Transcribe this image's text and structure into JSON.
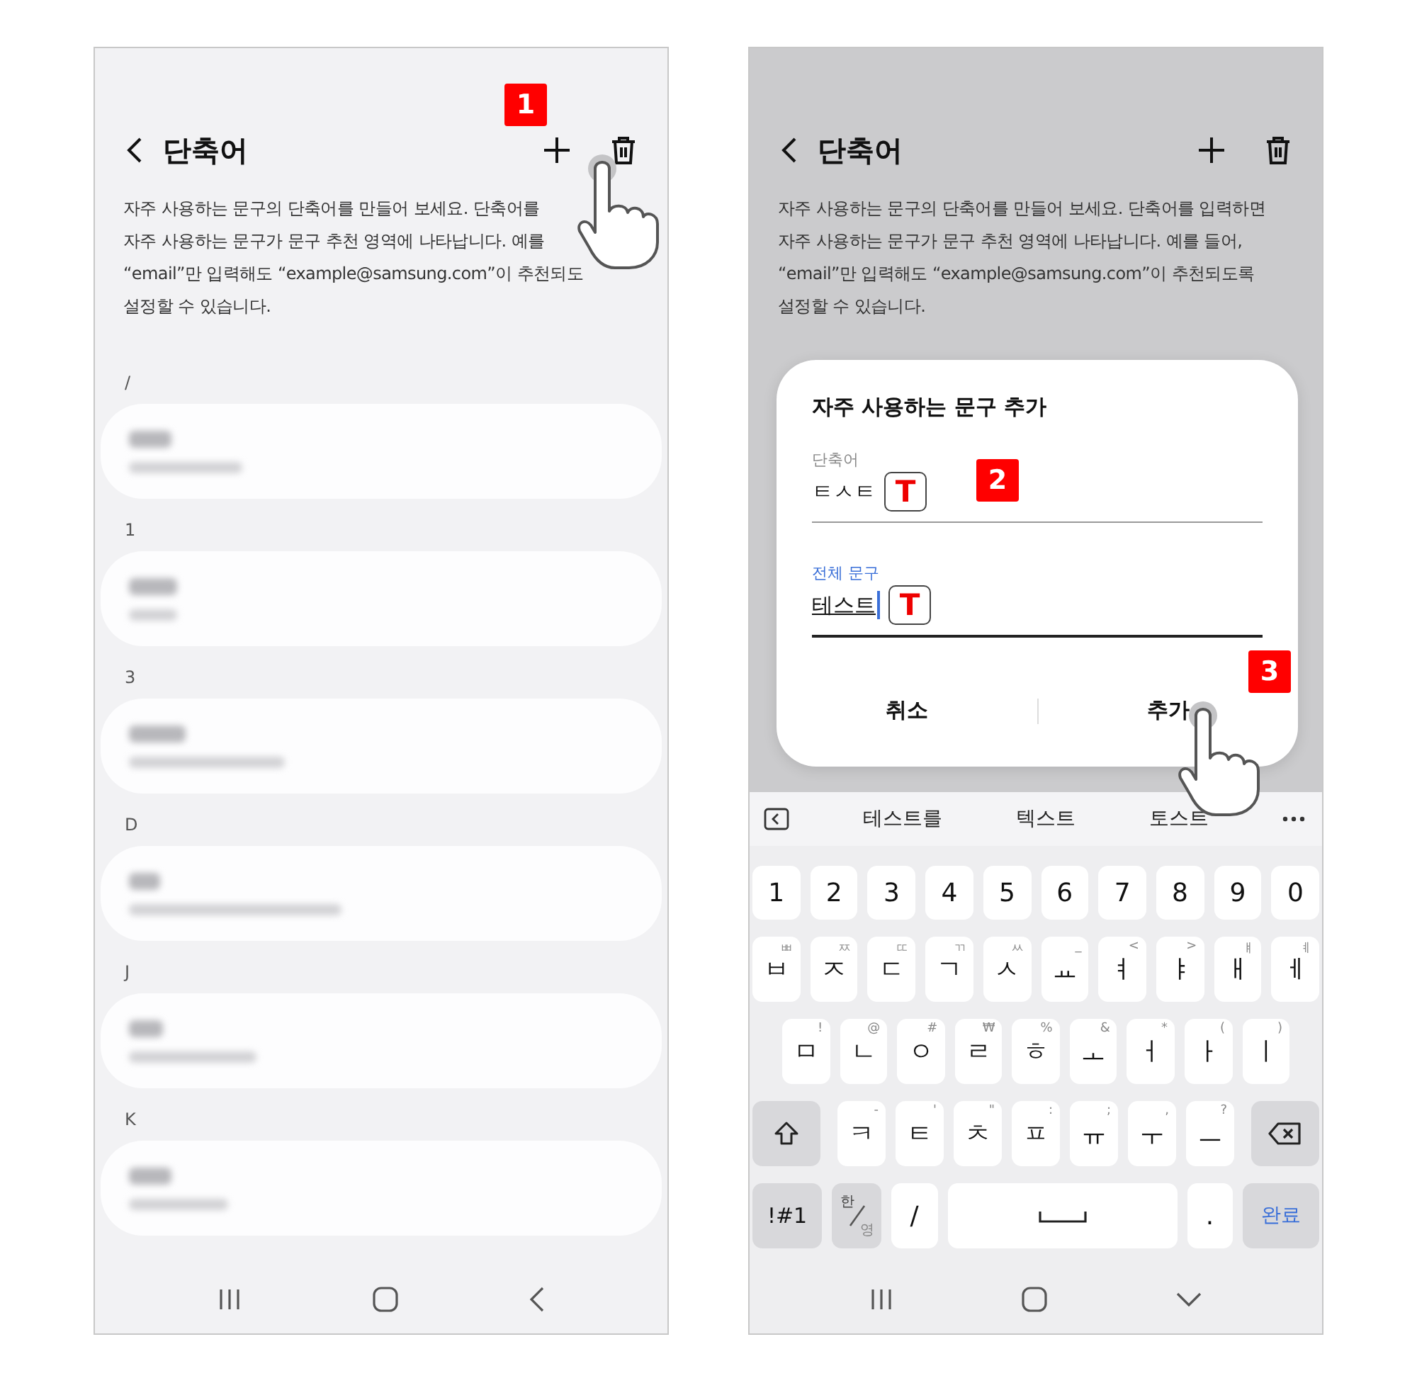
{
  "left_screen": {
    "title": "단축어",
    "step": "1",
    "description": [
      "자주 사용하는 문구의 단축어를 만들어 보세요. 단축어를",
      "자주 사용하는 문구가 문구 추천 영역에 나타납니다. 예를",
      "“email”만 입력해도 “example@samsung.com”이 추천되도",
      "설정할 수 있습니다."
    ],
    "sections": [
      {
        "header": "/"
      },
      {
        "header": "1"
      },
      {
        "header": "3"
      },
      {
        "header": "D"
      },
      {
        "header": "J"
      },
      {
        "header": "K"
      }
    ]
  },
  "right_screen": {
    "title": "단축어",
    "description": [
      "자주 사용하는 문구의 단축어를 만들어 보세요. 단축어를 입력하면",
      "자주 사용하는 문구가 문구 추천 영역에 나타납니다. 예를 들어,",
      "“email”만 입력해도 “example@samsung.com”이 추천되도록",
      "설정할 수 있습니다."
    ],
    "dialog": {
      "title": "자주 사용하는 문구 추가",
      "fields": [
        {
          "label": "단축어",
          "value": "ㅌㅅㅌ",
          "badge": "T",
          "focused": false,
          "step": "2"
        },
        {
          "label": "전체 문구",
          "value": "테스트",
          "badge": "T",
          "focused": true
        }
      ],
      "buttons": [
        {
          "label": "취소"
        },
        {
          "label": "추가",
          "step": "3"
        }
      ]
    },
    "keyboard": {
      "suggestions": [
        "테스트를",
        "텍스트",
        "토스트"
      ],
      "rows": [
        [
          {
            "kind": "char",
            "main": "1"
          },
          {
            "kind": "char",
            "main": "2"
          },
          {
            "kind": "char",
            "main": "3"
          },
          {
            "kind": "char",
            "main": "4"
          },
          {
            "kind": "char",
            "main": "5"
          },
          {
            "kind": "char",
            "main": "6"
          },
          {
            "kind": "char",
            "main": "7"
          },
          {
            "kind": "char",
            "main": "8"
          },
          {
            "kind": "char",
            "main": "9"
          },
          {
            "kind": "char",
            "main": "0"
          }
        ],
        [
          {
            "kind": "char",
            "main": "ㅂ",
            "hint": "ㅃ"
          },
          {
            "kind": "char",
            "main": "ㅈ",
            "hint": "ㅉ"
          },
          {
            "kind": "char",
            "main": "ㄷ",
            "hint": "ㄸ"
          },
          {
            "kind": "char",
            "main": "ㄱ",
            "hint": "ㄲ"
          },
          {
            "kind": "char",
            "main": "ㅅ",
            "hint": "ㅆ"
          },
          {
            "kind": "char",
            "main": "ㅛ",
            "hint": "_"
          },
          {
            "kind": "char",
            "main": "ㅕ",
            "hint": "<"
          },
          {
            "kind": "char",
            "main": "ㅑ",
            "hint": ">"
          },
          {
            "kind": "char",
            "main": "ㅐ",
            "hint": "ㅒ"
          },
          {
            "kind": "char",
            "main": "ㅔ",
            "hint": "ㅖ"
          }
        ],
        [
          {
            "kind": "char",
            "main": "ㅁ",
            "hint": "!"
          },
          {
            "kind": "char",
            "main": "ㄴ",
            "hint": "@"
          },
          {
            "kind": "char",
            "main": "ㅇ",
            "hint": "#"
          },
          {
            "kind": "char",
            "main": "ㄹ",
            "hint": "₩"
          },
          {
            "kind": "char",
            "main": "ㅎ",
            "hint": "%"
          },
          {
            "kind": "char",
            "main": "ㅗ",
            "hint": "&"
          },
          {
            "kind": "char",
            "main": "ㅓ",
            "hint": "*"
          },
          {
            "kind": "char",
            "main": "ㅏ",
            "hint": "("
          },
          {
            "kind": "char",
            "main": "ㅣ",
            "hint": ")"
          }
        ],
        [
          {
            "kind": "shift"
          },
          {
            "kind": "char",
            "main": "ㅋ",
            "hint": "-"
          },
          {
            "kind": "char",
            "main": "ㅌ",
            "hint": "'"
          },
          {
            "kind": "char",
            "main": "ㅊ",
            "hint": "\""
          },
          {
            "kind": "char",
            "main": "ㅍ",
            "hint": ":"
          },
          {
            "kind": "char",
            "main": "ㅠ",
            "hint": ";"
          },
          {
            "kind": "char",
            "main": "ㅜ",
            "hint": ","
          },
          {
            "kind": "char",
            "main": "ㅡ",
            "hint": "?"
          },
          {
            "kind": "backspace"
          }
        ],
        [
          {
            "kind": "symbols",
            "main": "!#1"
          },
          {
            "kind": "lang",
            "top": "한",
            "bottom": "영"
          },
          {
            "kind": "char",
            "main": "/"
          },
          {
            "kind": "space"
          },
          {
            "kind": "char",
            "main": "."
          },
          {
            "kind": "done",
            "main": "완료"
          }
        ]
      ]
    }
  }
}
